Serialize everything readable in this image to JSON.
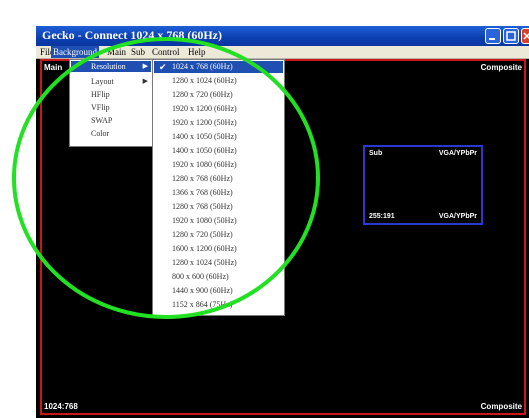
{
  "window": {
    "title": "Gecko - Connect 1024 x 768 (60Hz)"
  },
  "menubar": {
    "items": [
      "File",
      "Background",
      "Main",
      "Sub",
      "Control",
      "Help"
    ]
  },
  "video": {
    "top_left": "Main",
    "top_right": "Composite",
    "bottom_left": "1024:768",
    "bottom_right": "Composite"
  },
  "pip": {
    "top_left": "Sub",
    "top_right": "VGA/YPbPr",
    "bottom_left": "255:191",
    "bottom_right": "VGA/YPbPr"
  },
  "submenu": {
    "items": [
      "Resolution",
      "Layout",
      "HFlip",
      "VFlip",
      "SWAP",
      "Color"
    ]
  },
  "resolutions": {
    "selected": "1024 x 768 (60Hz)",
    "items": [
      "1024 x 768 (60Hz)",
      "1280 x 1024 (60Hz)",
      "1280 x 720 (60Hz)",
      "1920 x 1200 (60Hz)",
      "1920 x 1200 (50Hz)",
      "1400 x 1050 (50Hz)",
      "1400 x 1050 (60Hz)",
      "1920 x 1080 (60Hz)",
      "1280 x 768 (60Hz)",
      "1366 x 768 (60Hz)",
      "1280 x 768 (50Hz)",
      "1920 x 1080 (50Hz)",
      "1280 x 720 (50Hz)",
      "1600 x 1200 (60Hz)",
      "1280 x 1024 (50Hz)",
      "800 x 600 (60Hz)",
      "1440 x 900 (60Hz)",
      "1152 x 864 (75Hz)"
    ]
  },
  "colors": {
    "highlight": "#1f4fb0",
    "border_red": "#c81818",
    "pip_border": "#2a38d0",
    "annotation": "#22e022"
  }
}
